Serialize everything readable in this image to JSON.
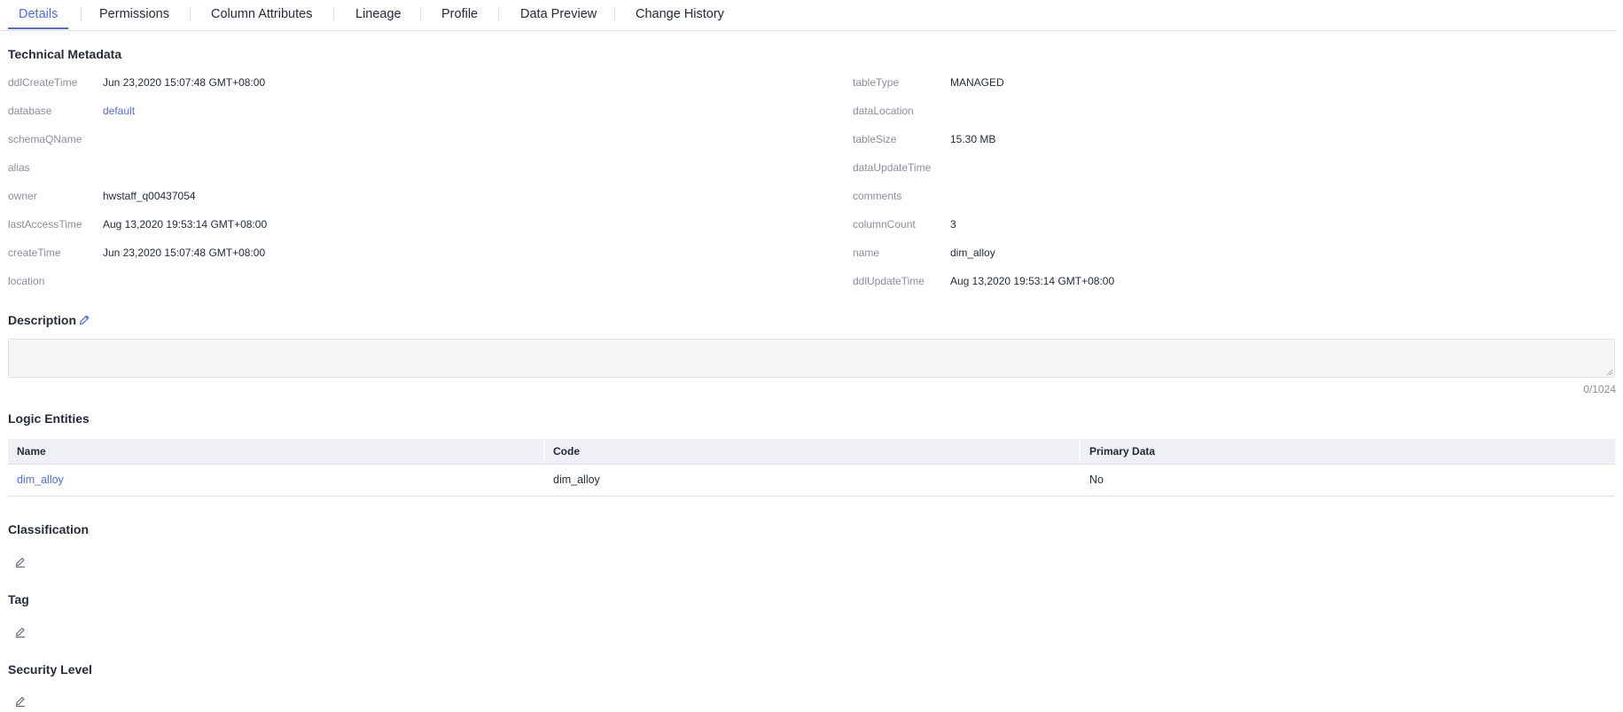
{
  "tabs": [
    {
      "label": "Details",
      "active": true
    },
    {
      "label": "Permissions",
      "active": false
    },
    {
      "label": "Column Attributes",
      "active": false
    },
    {
      "label": "Lineage",
      "active": false
    },
    {
      "label": "Profile",
      "active": false
    },
    {
      "label": "Data Preview",
      "active": false
    },
    {
      "label": "Change History",
      "active": false
    }
  ],
  "technical_metadata": {
    "title": "Technical Metadata",
    "left": [
      {
        "key": "ddlCreateTime",
        "value": "Jun 23,2020 15:07:48 GMT+08:00"
      },
      {
        "key": "database",
        "value": "default"
      },
      {
        "key": "schemaQName",
        "value": ""
      },
      {
        "key": "alias",
        "value": ""
      },
      {
        "key": "owner",
        "value": "hwstaff_q00437054"
      },
      {
        "key": "lastAccessTime",
        "value": "Aug 13,2020 19:53:14 GMT+08:00"
      },
      {
        "key": "createTime",
        "value": "Jun 23,2020 15:07:48 GMT+08:00"
      },
      {
        "key": "location",
        "value": ""
      }
    ],
    "right": [
      {
        "key": "tableType",
        "value": "MANAGED"
      },
      {
        "key": "dataLocation",
        "value": ""
      },
      {
        "key": "tableSize",
        "value": "15.30 MB"
      },
      {
        "key": "dataUpdateTime",
        "value": ""
      },
      {
        "key": "comments",
        "value": ""
      },
      {
        "key": "columnCount",
        "value": "3"
      },
      {
        "key": "name",
        "value": "dim_alloy"
      },
      {
        "key": "ddlUpdateTime",
        "value": "Aug 13,2020 19:53:14 GMT+08:00"
      }
    ]
  },
  "description": {
    "title": "Description",
    "value": "",
    "counter": "0/1024"
  },
  "logic_entities": {
    "title": "Logic Entities",
    "columns": [
      "Name",
      "Code",
      "Primary Data"
    ],
    "rows": [
      [
        "dim_alloy",
        "dim_alloy",
        "No"
      ]
    ]
  },
  "classification": {
    "title": "Classification"
  },
  "tag": {
    "title": "Tag"
  },
  "security_level": {
    "title": "Security Level"
  },
  "colors": {
    "accent": "#526ecc",
    "label_gray": "#8a8e99",
    "text": "#252b3a"
  },
  "icons": {
    "description_edit": "pencil-icon",
    "section_edit": "edit-icon"
  }
}
